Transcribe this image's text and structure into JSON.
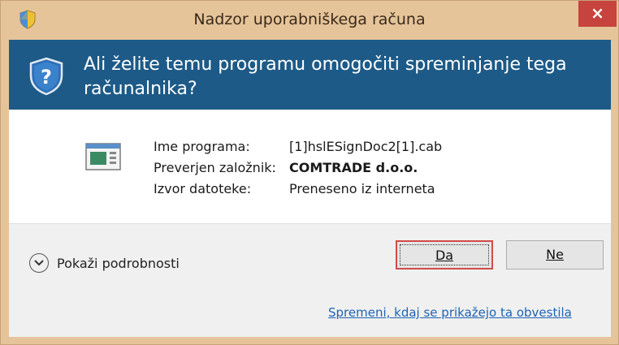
{
  "window": {
    "title": "Nadzor uporabniškega računa",
    "close_label": "×"
  },
  "banner": {
    "question": "Ali želite temu programu omogočiti spreminjanje tega računalnika?"
  },
  "info": {
    "rows": [
      {
        "label": "Ime programa:",
        "value": "[1]hslESignDoc2[1].cab"
      },
      {
        "label": "Preverjen založnik:",
        "value": "COMTRADE d.o.o."
      },
      {
        "label": "Izvor datoteke:",
        "value": "Preneseno iz interneta"
      }
    ]
  },
  "footer": {
    "details_label": "Pokaži podrobnosti",
    "yes_button": "Da",
    "no_button": "Ne",
    "link": "Spremeni, kdaj se prikažejo ta obvestila"
  },
  "colors": {
    "banner": "#1d5a87",
    "frame": "#e6c49a",
    "close": "#c7433d",
    "link": "#1f63b3"
  }
}
